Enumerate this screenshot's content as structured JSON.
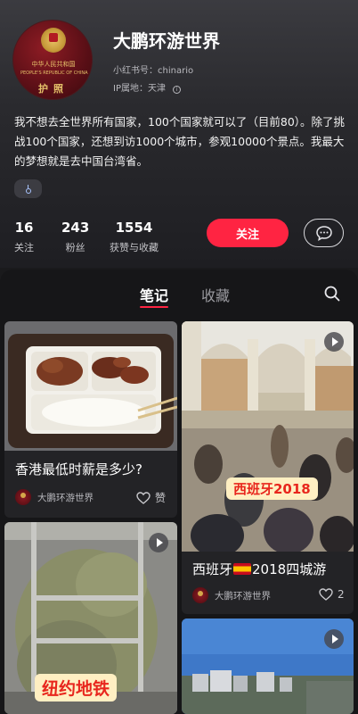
{
  "profile": {
    "name": "大鹏环游世界",
    "id_line": "小红书号：chinario",
    "ip_line": "IP属地：天津",
    "ip_info_icon": "info-icon",
    "bio": "我不想去全世界所有国家，100个国家就可以了（目前80）。除了挑战100个国家，还想到访1000个城市，参观10000个景点。我最大的梦想就是去中国台湾省。",
    "gender_icon": "male-icon",
    "avatar": {
      "line1": "中华人民共和国",
      "line2": "PEOPLE'S REPUBLIC OF CHINA",
      "title": "护照"
    }
  },
  "stats": [
    {
      "value": "16",
      "label": "关注"
    },
    {
      "value": "243",
      "label": "粉丝"
    },
    {
      "value": "1554",
      "label": "获赞与收藏"
    }
  ],
  "actions": {
    "follow_label": "关注",
    "message_icon": "chat-bubble-icon"
  },
  "tabs": [
    {
      "label": "笔记",
      "active": true
    },
    {
      "label": "收藏",
      "active": false
    }
  ],
  "search_icon": "search-icon",
  "notes": [
    {
      "title": "香港最低时薪是多少?",
      "author": "大鹏环游世界",
      "likes": "赞",
      "video": false
    },
    {
      "title_before": "西班牙",
      "title_after": "2018四城游",
      "overlay": "西班牙2018",
      "author": "大鹏环游世界",
      "likes": "2",
      "video": true
    },
    {
      "overlay": "纽约地铁",
      "video": true
    },
    {
      "video": true
    }
  ],
  "colors": {
    "accent": "#ff2442",
    "background": "#1a1a1c",
    "card": "#232326",
    "overlay_bg": "#ffefc2",
    "overlay_text": "#e8261d"
  }
}
